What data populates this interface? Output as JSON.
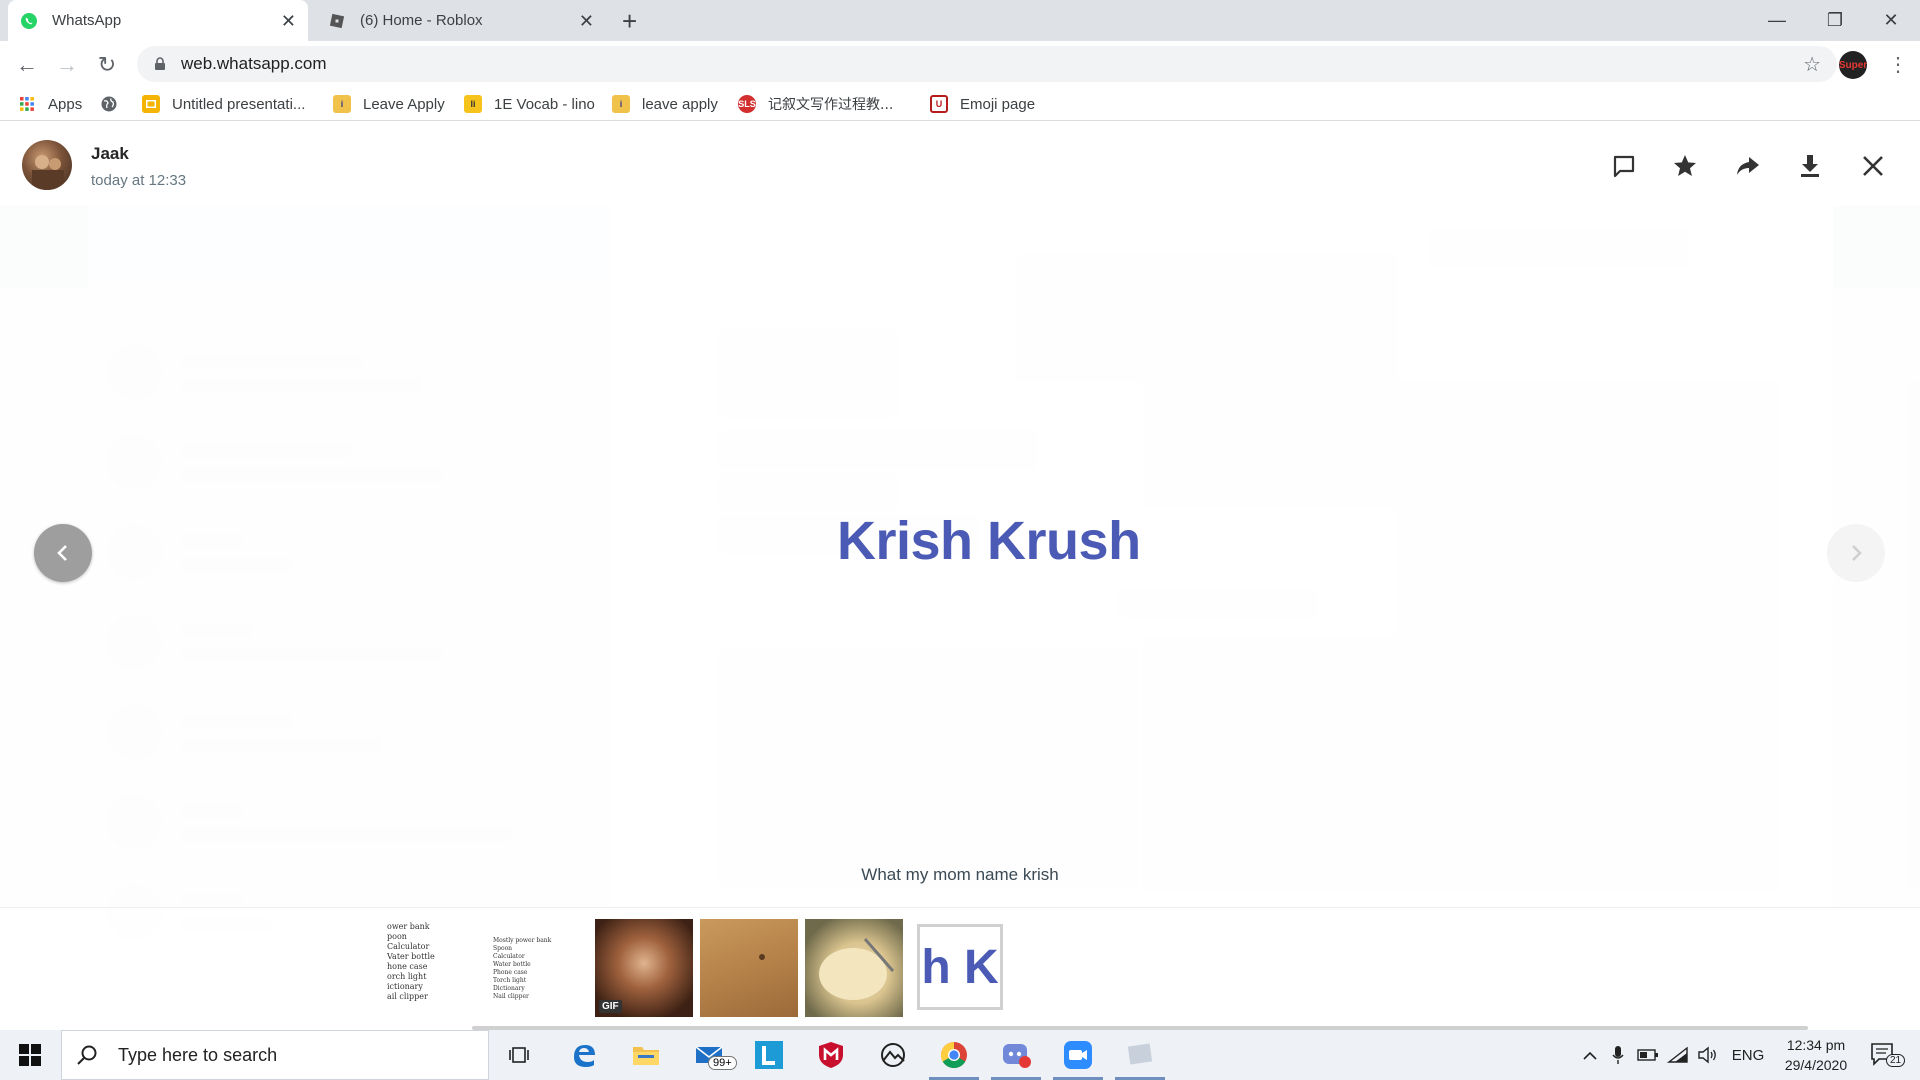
{
  "browser": {
    "tabs": [
      {
        "title": "WhatsApp",
        "active": true
      },
      {
        "title": "(6) Home - Roblox",
        "active": false
      }
    ],
    "url": "web.whatsapp.com",
    "bookmarks": [
      {
        "label": "Apps"
      },
      {
        "label": ""
      },
      {
        "label": "Untitled presentati..."
      },
      {
        "label": "Leave Apply"
      },
      {
        "label": "1E Vocab - lino"
      },
      {
        "label": "leave apply"
      },
      {
        "label": "记叙文写作过程教..."
      },
      {
        "label": "Emoji page"
      }
    ],
    "profile_label": "Super"
  },
  "viewer": {
    "sender_name": "Jaak",
    "timestamp": "today at 12:33",
    "actions": [
      "reply-icon",
      "star-icon",
      "forward-icon",
      "download-icon",
      "close-icon"
    ],
    "media_text": "Krish Krush",
    "caption": "What my mom name krish",
    "thumbnails": [
      {
        "type": "document",
        "lines": [
          "ower bank",
          "poon",
          "Calculator",
          "Vater bottle",
          "hone case",
          "orch light",
          "ictionary",
          "ail clipper"
        ]
      },
      {
        "type": "document",
        "lines": [
          "Mostly power bank",
          "Spoon",
          "Calculator",
          "Water bottle",
          "Phone case",
          "Torch light",
          "Dictionary",
          "Nail clipper"
        ]
      },
      {
        "type": "gif",
        "badge": "GIF"
      },
      {
        "type": "photo"
      },
      {
        "type": "photo"
      },
      {
        "type": "image-text",
        "text": "h K",
        "selected": true
      }
    ]
  },
  "taskbar": {
    "search_placeholder": "Type here to search",
    "mail_badge": "99+",
    "language": "ENG",
    "time": "12:34 pm",
    "date": "29/4/2020",
    "notification_count": "21"
  },
  "colors": {
    "whatsapp_green": "#25d366",
    "media_text": "#4b5bb5",
    "tab_strip": "#dee1e6"
  }
}
